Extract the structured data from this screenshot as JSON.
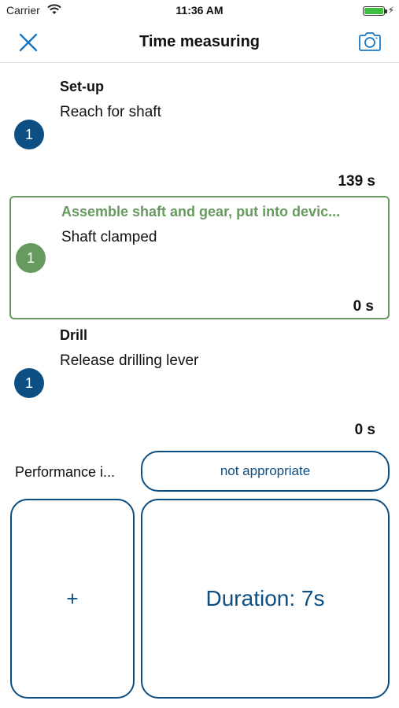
{
  "status_bar": {
    "carrier": "Carrier",
    "time": "11:36 AM",
    "battery_level": 1.0,
    "battery_color": "#3fbf3f"
  },
  "nav": {
    "title": "Time measuring",
    "left_icon": "close-icon",
    "right_icon": "camera-icon"
  },
  "colors": {
    "primary": "#0d4f82",
    "active": "#679a5f"
  },
  "steps": [
    {
      "title": "Set-up",
      "description": "Reach for shaft",
      "badge": "1",
      "time": "139 s",
      "active": false
    },
    {
      "title": "Assemble shaft and gear, put into devic...",
      "description": "Shaft clamped",
      "badge": "1",
      "time": "0 s",
      "active": true
    },
    {
      "title": "Drill",
      "description": "Release drilling lever",
      "badge": "1",
      "time": "0 s",
      "active": false
    }
  ],
  "performance": {
    "label": "Performance i...",
    "value": "not appropriate"
  },
  "actions": {
    "add_label": "+",
    "duration_label": "Duration: 7s"
  }
}
